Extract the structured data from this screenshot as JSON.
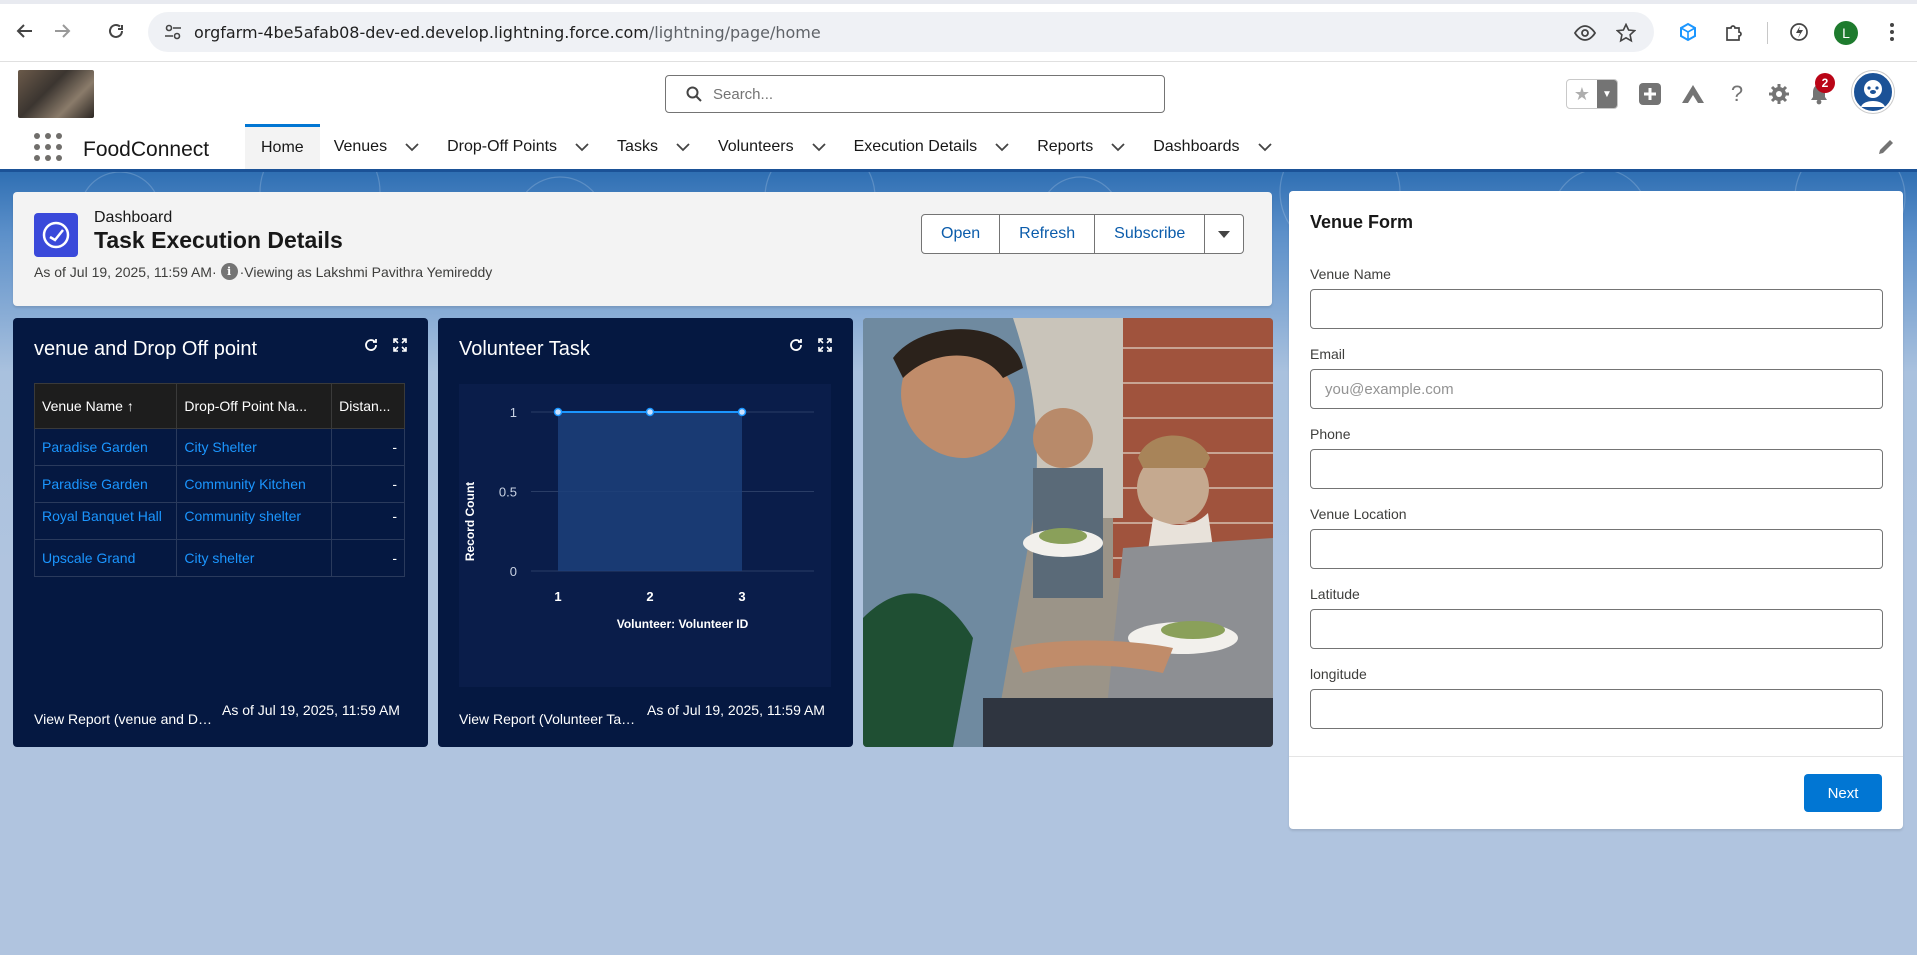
{
  "browser": {
    "url_host": "orgfarm-4be5afab08-dev-ed.develop.lightning.force.com",
    "url_path": "/lightning/page/home",
    "profile_initial": "L"
  },
  "header": {
    "search_placeholder": "Search...",
    "notification_count": "2"
  },
  "nav": {
    "app_name": "FoodConnect",
    "items": [
      {
        "label": "Home",
        "active": true,
        "dropdown": false
      },
      {
        "label": "Venues",
        "dropdown": true
      },
      {
        "label": "Drop-Off Points",
        "dropdown": true
      },
      {
        "label": "Tasks",
        "dropdown": true
      },
      {
        "label": "Volunteers",
        "dropdown": true
      },
      {
        "label": "Execution Details",
        "dropdown": true
      },
      {
        "label": "Reports",
        "dropdown": true
      },
      {
        "label": "Dashboards",
        "dropdown": true
      }
    ]
  },
  "dashboard": {
    "label": "Dashboard",
    "title": "Task Execution Details",
    "as_of": "As of Jul 19, 2025, 11:59 AM·",
    "viewing_as": "·Viewing as Lakshmi Pavithra Yemireddy",
    "buttons": {
      "open": "Open",
      "refresh": "Refresh",
      "subscribe": "Subscribe"
    }
  },
  "widget_table": {
    "title": "venue and Drop Off point",
    "columns": [
      "Venue Name ↑",
      "Drop-Off Point Na...",
      "Distan..."
    ],
    "rows": [
      [
        "Paradise Garden",
        "City Shelter",
        "-"
      ],
      [
        "Paradise Garden",
        "Community Kitchen",
        "-"
      ],
      [
        "Royal Banquet Hall",
        "Community shelter",
        "-"
      ],
      [
        "Upscale Grand",
        "City shelter",
        "-"
      ]
    ],
    "footer_link": "View Report (venue and Drop Off point)",
    "footer_asof": "As of Jul 19, 2025, 11:59 AM"
  },
  "widget_chart": {
    "title": "Volunteer Task",
    "footer_link": "View Report (Volunteer Task)",
    "footer_asof": "As of Jul 19, 2025, 11:59 AM"
  },
  "chart_data": {
    "type": "area",
    "x": [
      "1",
      "2",
      "3"
    ],
    "values": [
      1,
      1,
      1
    ],
    "xlabel": "Volunteer: Volunteer ID",
    "ylabel": "Record Count",
    "ylim": [
      0,
      1
    ],
    "yticks": [
      "0",
      "0.5",
      "1"
    ],
    "grid": true,
    "color": "#1b96ff"
  },
  "venue_form": {
    "title": "Venue Form",
    "fields": [
      {
        "label": "Venue Name",
        "placeholder": "",
        "value": ""
      },
      {
        "label": "Email",
        "placeholder": "you@example.com",
        "value": ""
      },
      {
        "label": "Phone",
        "placeholder": "",
        "value": ""
      },
      {
        "label": "Venue Location",
        "placeholder": "",
        "value": ""
      },
      {
        "label": "Latitude",
        "placeholder": "",
        "value": ""
      },
      {
        "label": "longitude",
        "placeholder": "",
        "value": ""
      }
    ],
    "next_label": "Next"
  },
  "colors": {
    "brand": "#0176d3",
    "widget_bg": "#051841",
    "link": "#1b96ff"
  }
}
